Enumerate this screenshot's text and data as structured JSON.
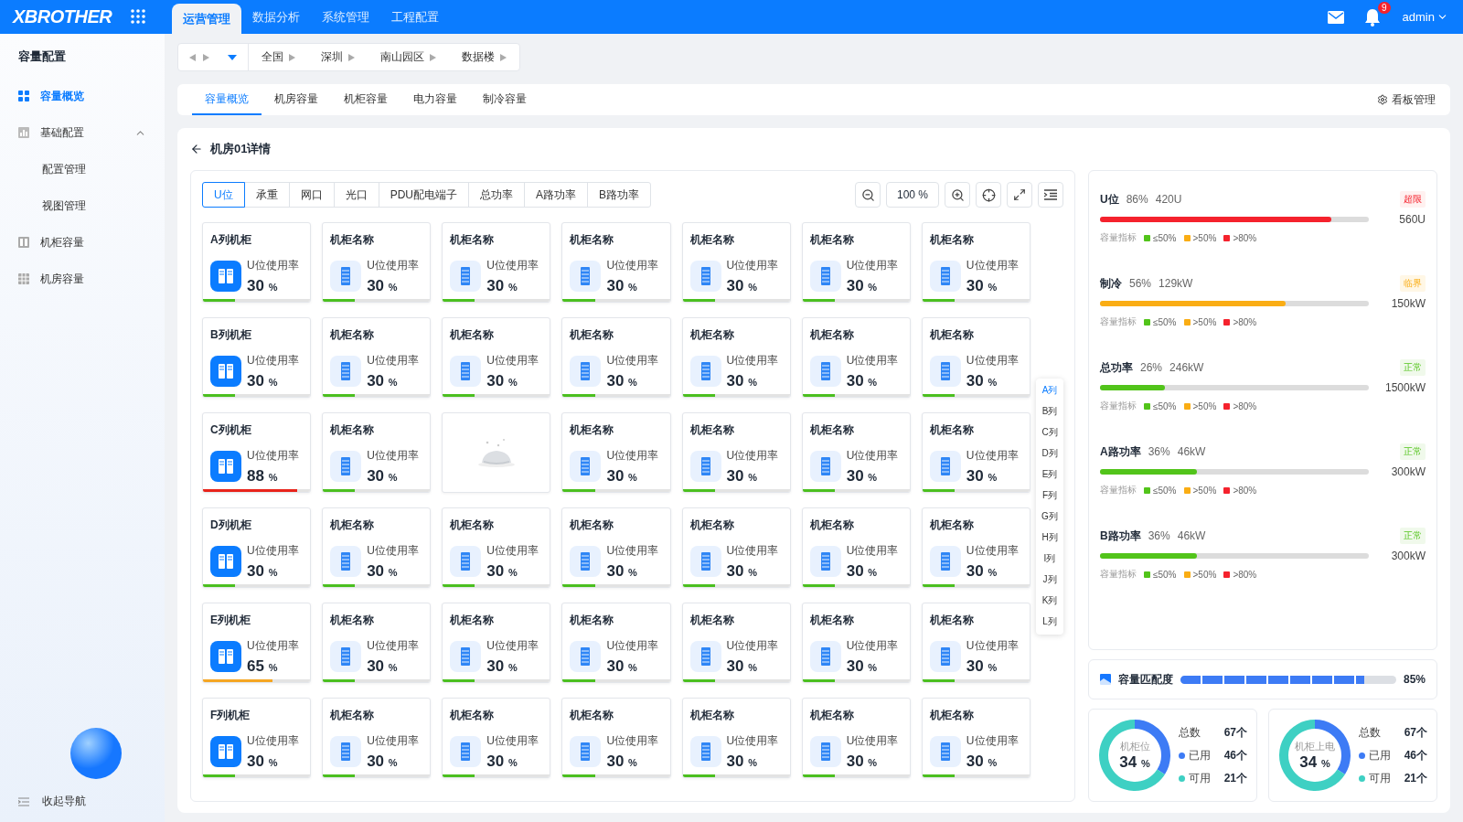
{
  "topbar": {
    "logo": "XBROTHER",
    "nav": [
      {
        "label": "运营管理",
        "selected": true
      },
      {
        "label": "数据分析",
        "selected": false
      },
      {
        "label": "系统管理",
        "selected": false
      },
      {
        "label": "工程配置",
        "selected": false
      }
    ],
    "notifications": "9",
    "user": "admin"
  },
  "sidebar": {
    "title": "容量配置",
    "items": [
      {
        "label": "容量概览",
        "selected": true
      },
      {
        "label": "基础配置",
        "selected": false,
        "expanded": true,
        "children": [
          {
            "label": "配置管理",
            "selected": false
          },
          {
            "label": "视图管理",
            "selected": false
          }
        ]
      },
      {
        "label": "机柜容量",
        "selected": false
      },
      {
        "label": "机房容量",
        "selected": false
      }
    ],
    "collapse": "收起导航"
  },
  "breadcrumb": [
    "全国",
    "深圳",
    "南山园区",
    "数据楼"
  ],
  "tabs": [
    {
      "label": "容量概览",
      "selected": true
    },
    {
      "label": "机房容量",
      "selected": false
    },
    {
      "label": "机柜容量",
      "selected": false
    },
    {
      "label": "电力容量",
      "selected": false
    },
    {
      "label": "制冷容量",
      "selected": false
    }
  ],
  "board_button": "看板管理",
  "detail_title": "机房01详情",
  "metric_tabs": [
    {
      "label": "U位",
      "selected": true
    },
    {
      "label": "承重",
      "selected": false
    },
    {
      "label": "网口",
      "selected": false
    },
    {
      "label": "光口",
      "selected": false
    },
    {
      "label": "PDU配电端子",
      "selected": false
    },
    {
      "label": "总功率",
      "selected": false
    },
    {
      "label": "A路功率",
      "selected": false
    },
    {
      "label": "B路功率",
      "selected": false
    }
  ],
  "zoom": "100 %",
  "cards": [
    {
      "kind": "row",
      "title": "A列机柜",
      "label": "U位使用率",
      "value": "30",
      "unit": "%",
      "level": 0.3
    },
    {
      "kind": "cabinet",
      "title": "机柜名称",
      "label": "U位使用率",
      "value": "30",
      "unit": "%",
      "level": 0.3
    },
    {
      "kind": "cabinet",
      "title": "机柜名称",
      "label": "U位使用率",
      "value": "30",
      "unit": "%",
      "level": 0.3
    },
    {
      "kind": "cabinet",
      "title": "机柜名称",
      "label": "U位使用率",
      "value": "30",
      "unit": "%",
      "level": 0.3
    },
    {
      "kind": "cabinet",
      "title": "机柜名称",
      "label": "U位使用率",
      "value": "30",
      "unit": "%",
      "level": 0.3
    },
    {
      "kind": "cabinet",
      "title": "机柜名称",
      "label": "U位使用率",
      "value": "30",
      "unit": "%",
      "level": 0.3
    },
    {
      "kind": "cabinet",
      "title": "机柜名称",
      "label": "U位使用率",
      "value": "30",
      "unit": "%",
      "level": 0.3
    },
    {
      "kind": "row",
      "title": "B列机柜",
      "label": "U位使用率",
      "value": "30",
      "unit": "%",
      "level": 0.3
    },
    {
      "kind": "cabinet",
      "title": "机柜名称",
      "label": "U位使用率",
      "value": "30",
      "unit": "%",
      "level": 0.3
    },
    {
      "kind": "cabinet",
      "title": "机柜名称",
      "label": "U位使用率",
      "value": "30",
      "unit": "%",
      "level": 0.3
    },
    {
      "kind": "cabinet",
      "title": "机柜名称",
      "label": "U位使用率",
      "value": "30",
      "unit": "%",
      "level": 0.3
    },
    {
      "kind": "cabinet",
      "title": "机柜名称",
      "label": "U位使用率",
      "value": "30",
      "unit": "%",
      "level": 0.3
    },
    {
      "kind": "cabinet",
      "title": "机柜名称",
      "label": "U位使用率",
      "value": "30",
      "unit": "%",
      "level": 0.3
    },
    {
      "kind": "cabinet",
      "title": "机柜名称",
      "label": "U位使用率",
      "value": "30",
      "unit": "%",
      "level": 0.3
    },
    {
      "kind": "row",
      "title": "C列机柜",
      "label": "U位使用率",
      "value": "88",
      "unit": "%",
      "level": 0.88
    },
    {
      "kind": "cabinet",
      "title": "机柜名称",
      "label": "U位使用率",
      "value": "30",
      "unit": "%",
      "level": 0.3
    },
    {
      "kind": "empty"
    },
    {
      "kind": "cabinet",
      "title": "机柜名称",
      "label": "U位使用率",
      "value": "30",
      "unit": "%",
      "level": 0.3
    },
    {
      "kind": "cabinet",
      "title": "机柜名称",
      "label": "U位使用率",
      "value": "30",
      "unit": "%",
      "level": 0.3
    },
    {
      "kind": "cabinet",
      "title": "机柜名称",
      "label": "U位使用率",
      "value": "30",
      "unit": "%",
      "level": 0.3
    },
    {
      "kind": "cabinet",
      "title": "机柜名称",
      "label": "U位使用率",
      "value": "30",
      "unit": "%",
      "level": 0.3
    },
    {
      "kind": "row",
      "title": "D列机柜",
      "label": "U位使用率",
      "value": "30",
      "unit": "%",
      "level": 0.3
    },
    {
      "kind": "cabinet",
      "title": "机柜名称",
      "label": "U位使用率",
      "value": "30",
      "unit": "%",
      "level": 0.3
    },
    {
      "kind": "cabinet",
      "title": "机柜名称",
      "label": "U位使用率",
      "value": "30",
      "unit": "%",
      "level": 0.3
    },
    {
      "kind": "cabinet",
      "title": "机柜名称",
      "label": "U位使用率",
      "value": "30",
      "unit": "%",
      "level": 0.3
    },
    {
      "kind": "cabinet",
      "title": "机柜名称",
      "label": "U位使用率",
      "value": "30",
      "unit": "%",
      "level": 0.3
    },
    {
      "kind": "cabinet",
      "title": "机柜名称",
      "label": "U位使用率",
      "value": "30",
      "unit": "%",
      "level": 0.3
    },
    {
      "kind": "cabinet",
      "title": "机柜名称",
      "label": "U位使用率",
      "value": "30",
      "unit": "%",
      "level": 0.3
    },
    {
      "kind": "row",
      "title": "E列机柜",
      "label": "U位使用率",
      "value": "65",
      "unit": "%",
      "level": 0.65
    },
    {
      "kind": "cabinet",
      "title": "机柜名称",
      "label": "U位使用率",
      "value": "30",
      "unit": "%",
      "level": 0.3
    },
    {
      "kind": "cabinet",
      "title": "机柜名称",
      "label": "U位使用率",
      "value": "30",
      "unit": "%",
      "level": 0.3
    },
    {
      "kind": "cabinet",
      "title": "机柜名称",
      "label": "U位使用率",
      "value": "30",
      "unit": "%",
      "level": 0.3
    },
    {
      "kind": "cabinet",
      "title": "机柜名称",
      "label": "U位使用率",
      "value": "30",
      "unit": "%",
      "level": 0.3
    },
    {
      "kind": "cabinet",
      "title": "机柜名称",
      "label": "U位使用率",
      "value": "30",
      "unit": "%",
      "level": 0.3
    },
    {
      "kind": "cabinet",
      "title": "机柜名称",
      "label": "U位使用率",
      "value": "30",
      "unit": "%",
      "level": 0.3
    },
    {
      "kind": "row",
      "title": "F列机柜",
      "label": "U位使用率",
      "value": "30",
      "unit": "%",
      "level": 0.3
    },
    {
      "kind": "cabinet",
      "title": "机柜名称",
      "label": "U位使用率",
      "value": "30",
      "unit": "%",
      "level": 0.3
    },
    {
      "kind": "cabinet",
      "title": "机柜名称",
      "label": "U位使用率",
      "value": "30",
      "unit": "%",
      "level": 0.3
    },
    {
      "kind": "cabinet",
      "title": "机柜名称",
      "label": "U位使用率",
      "value": "30",
      "unit": "%",
      "level": 0.3
    },
    {
      "kind": "cabinet",
      "title": "机柜名称",
      "label": "U位使用率",
      "value": "30",
      "unit": "%",
      "level": 0.3
    },
    {
      "kind": "cabinet",
      "title": "机柜名称",
      "label": "U位使用率",
      "value": "30",
      "unit": "%",
      "level": 0.3
    },
    {
      "kind": "cabinet",
      "title": "机柜名称",
      "label": "U位使用率",
      "value": "30",
      "unit": "%",
      "level": 0.3
    }
  ],
  "row_index": [
    {
      "label": "A列",
      "selected": true
    },
    {
      "label": "B列",
      "selected": false
    },
    {
      "label": "C列",
      "selected": false
    },
    {
      "label": "D列",
      "selected": false
    },
    {
      "label": "E列",
      "selected": false
    },
    {
      "label": "F列",
      "selected": false
    },
    {
      "label": "G列",
      "selected": false
    },
    {
      "label": "H列",
      "selected": false
    },
    {
      "label": "I列",
      "selected": false
    },
    {
      "label": "J列",
      "selected": false
    },
    {
      "label": "K列",
      "selected": false
    },
    {
      "label": "L列",
      "selected": false
    }
  ],
  "metrics": [
    {
      "name": "U位",
      "percent": "86%",
      "amount": "420U",
      "status": {
        "label": "超限",
        "kind": "over"
      },
      "capacity": "560U",
      "level": 0.86,
      "legend_title": "容量指标",
      "legend": [
        {
          "label": "≤50%",
          "color": "#52c41a"
        },
        {
          "label": ">50%",
          "color": "#faad14"
        },
        {
          "label": ">80%",
          "color": "#f5222d"
        }
      ]
    },
    {
      "name": "制冷",
      "percent": "56%",
      "amount": "129kW",
      "status": {
        "label": "临界",
        "kind": "critical"
      },
      "capacity": "150kW",
      "level": 0.69,
      "legend_title": "容量指标",
      "legend": [
        {
          "label": "≤50%",
          "color": "#52c41a"
        },
        {
          "label": ">50%",
          "color": "#faad14"
        },
        {
          "label": ">80%",
          "color": "#f5222d"
        }
      ]
    },
    {
      "name": "总功率",
      "percent": "26%",
      "amount": "246kW",
      "status": {
        "label": "正常",
        "kind": "normal"
      },
      "capacity": "1500kW",
      "level": 0.24,
      "legend_title": "容量指标",
      "legend": [
        {
          "label": "≤50%",
          "color": "#52c41a"
        },
        {
          "label": ">50%",
          "color": "#faad14"
        },
        {
          "label": ">80%",
          "color": "#f5222d"
        }
      ]
    },
    {
      "name": "A路功率",
      "percent": "36%",
      "amount": "46kW",
      "status": {
        "label": "正常",
        "kind": "normal"
      },
      "capacity": "300kW",
      "level": 0.36,
      "legend_title": "容量指标",
      "legend": [
        {
          "label": "≤50%",
          "color": "#52c41a"
        },
        {
          "label": ">50%",
          "color": "#faad14"
        },
        {
          "label": ">80%",
          "color": "#f5222d"
        }
      ]
    },
    {
      "name": "B路功率",
      "percent": "36%",
      "amount": "46kW",
      "status": {
        "label": "正常",
        "kind": "normal"
      },
      "capacity": "300kW",
      "level": 0.36,
      "legend_title": "容量指标",
      "legend": [
        {
          "label": "≤50%",
          "color": "#52c41a"
        },
        {
          "label": ">50%",
          "color": "#faad14"
        },
        {
          "label": ">80%",
          "color": "#f5222d"
        }
      ]
    }
  ],
  "match": {
    "title": "容量匹配度",
    "level": 0.85,
    "reading": "85%"
  },
  "donuts": [
    {
      "title": "机柜位",
      "value": "34",
      "unit": "%",
      "chart_data": {
        "type": "donut",
        "values": [
          34,
          66
        ]
      },
      "stats": [
        {
          "label": "总数",
          "value": "67个"
        },
        {
          "label": "已用",
          "value": "46个",
          "color": "#3d7bf5"
        },
        {
          "label": "可用",
          "value": "21个",
          "color": "#3ed0c3"
        }
      ]
    },
    {
      "title": "机柜上电",
      "value": "34",
      "unit": "%",
      "chart_data": {
        "type": "donut",
        "values": [
          34,
          66
        ]
      },
      "stats": [
        {
          "label": "总数",
          "value": "67个"
        },
        {
          "label": "已用",
          "value": "46个",
          "color": "#3d7bf5"
        },
        {
          "label": "可用",
          "value": "21个",
          "color": "#3ed0c3"
        }
      ]
    }
  ]
}
